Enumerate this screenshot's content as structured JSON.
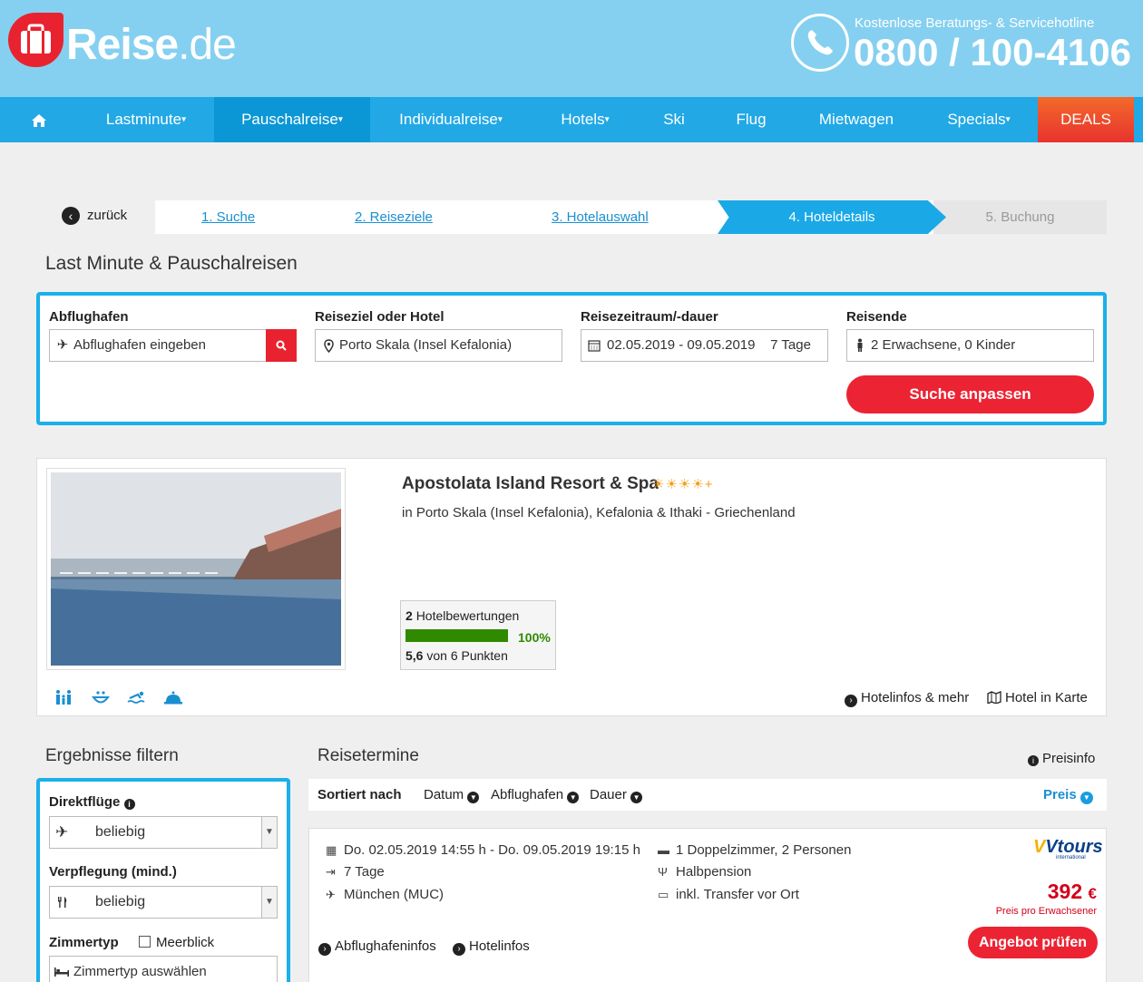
{
  "header": {
    "logo_main": "Reise",
    "logo_suffix": ".de",
    "hotline_label": "Kostenlose Beratungs- & Servicehotline",
    "hotline_number": "0800 / 100-4106"
  },
  "nav": {
    "items": [
      {
        "label": "Lastminute",
        "dropdown": true
      },
      {
        "label": "Pauschalreise",
        "dropdown": true
      },
      {
        "label": "Individualreise",
        "dropdown": true
      },
      {
        "label": "Hotels",
        "dropdown": true
      },
      {
        "label": "Ski",
        "dropdown": false
      },
      {
        "label": "Flug",
        "dropdown": false
      },
      {
        "label": "Mietwagen",
        "dropdown": false
      },
      {
        "label": "Specials",
        "dropdown": true
      },
      {
        "label": "DEALS",
        "dropdown": false
      }
    ]
  },
  "steps": {
    "back": "zurück",
    "items": [
      "1. Suche",
      "2. Reiseziele",
      "3. Hotelauswahl",
      "4. Hoteldetails",
      "5. Buchung"
    ]
  },
  "search": {
    "title": "Last Minute & Pauschalreisen",
    "departure_label": "Abflughafen",
    "departure_placeholder": "Abflughafen eingeben",
    "destination_label": "Reiseziel oder Hotel",
    "destination_value": "Porto Skala (Insel Kefalonia)",
    "period_label": "Reisezeitraum/-dauer",
    "period_dates": "02.05.2019 - 09.05.2019",
    "period_duration": "7 Tage",
    "travellers_label": "Reisende",
    "travellers_value": "2 Erwachsene, 0 Kinder",
    "submit": "Suche anpassen"
  },
  "hotel": {
    "name": "Apostolata Island Resort & Spa",
    "stars": "☀☀☀☀+",
    "location": "in Porto Skala (Insel Kefalonia), Kefalonia & Ithaki - Griechenland",
    "reviews_count": "2",
    "reviews_label": "Hotelbewertungen",
    "recommend_pct": "100%",
    "recommend_value": 1.0,
    "score": "5,6",
    "score_suffix": "von 6 Punkten",
    "amenities": [
      "family-icon",
      "spa-icon",
      "swimming-icon",
      "room-service-icon"
    ],
    "link_info": "Hotelinfos & mehr",
    "link_map": "Hotel in Karte"
  },
  "filter": {
    "title": "Ergebnisse filtern",
    "direct_label": "Direktflüge",
    "direct_value": "beliebig",
    "board_label": "Verpflegung (mind.)",
    "board_value": "beliebig",
    "room_label": "Zimmertyp",
    "seaview_label": "Meerblick",
    "room_placeholder": "Zimmertyp auswählen"
  },
  "results": {
    "title": "Reisetermine",
    "priceinfo": "Preisinfo",
    "sort_label": "Sortiert nach",
    "sort_options": [
      "Datum",
      "Abflughafen",
      "Dauer"
    ],
    "sort_active": "Preis",
    "offer": {
      "dates": "Do. 02.05.2019 14:55 h - Do. 09.05.2019 19:15 h",
      "duration": "7 Tage",
      "airport": "München (MUC)",
      "room": "1 Doppelzimmer, 2 Personen",
      "board": "Halbpension",
      "transfer": "inkl. Transfer vor Ort",
      "operator": "Vtours",
      "operator_sub": "international",
      "price": "392",
      "currency": "€",
      "price_note": "Preis pro Erwachsener",
      "cta": "Angebot prüfen",
      "link_airport": "Abflughafeninfos",
      "link_hotel": "Hotelinfos"
    }
  },
  "colors": {
    "brand_red": "#e8232f",
    "header_blue": "#85d0f0",
    "nav_blue": "#21a8e5",
    "accent_blue": "#1ab0ea",
    "rating_green": "#2f8a00"
  }
}
